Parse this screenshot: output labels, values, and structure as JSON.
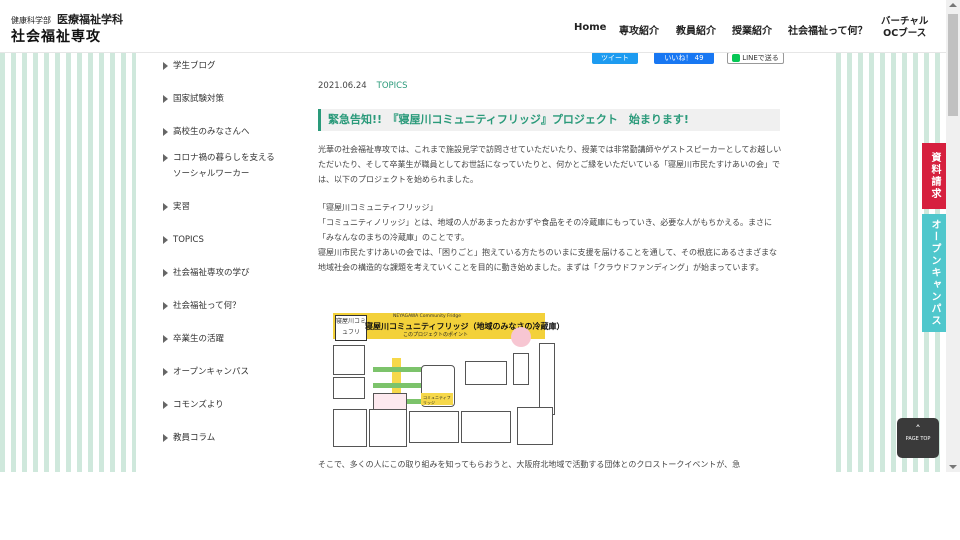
{
  "header": {
    "faculty": "健康科学部",
    "department": "医療福祉学科",
    "major": "社会福祉専攻"
  },
  "nav": {
    "items": [
      "Home",
      "専攻紹介",
      "教員紹介",
      "授業紹介",
      "社会福祉って何？"
    ],
    "virtual_oc_line1": "バーチャル",
    "virtual_oc_line2": "OCブース"
  },
  "share": {
    "tweet": "ツイート",
    "like": "いいね！ 49",
    "line": "LINEで送る"
  },
  "sidebar": {
    "items": [
      "学生ブログ",
      "国家試験対策",
      "高校生のみなさんへ",
      "コロナ禍の暮らしを支える",
      "ソーシャルワーカー",
      "実習",
      "TOPICS",
      "社会福祉専攻の学び",
      "社会福祉って何？",
      "卒業生の活躍",
      "オープンキャンパス",
      "コモンズより",
      "教員コラム"
    ]
  },
  "post": {
    "date": "2021.06.24",
    "category": "TOPICS",
    "title": "緊急告知!!　『寝屋川コミュニティフリッジ』プロジェクト　始まります!",
    "para1": "光華の社会福祉専攻では、これまで施設見学で訪問させていただいたり、授業では非常勤講師やゲストスピーカーとしてお越しいただいたり、そして卒業生が職員としてお世話になっていたりと、何かとご縁をいただいている「寝屋川市民たすけあいの会」では、以下のプロジェクトを始められました。",
    "para2": "「寝屋川コミュニティフリッジ」\n「コミュニティノリッジ」とは、地域の人があまったおかずや食品をその冷蔵庫にもっていき、必要な人がもちかえる。まさに「みなんなのまちの冷蔵庫」のことです。\n寝屋川市民たすけあいの会では、「困りごと」抱えている方たちのいまに支援を届けることを通して、その根底にあるさまざまな地域社会の構造的な課題を考えていくことを目的に動き始めました。まずは「クラウドファンディング」が始まっています。",
    "para3": "そこで、多くの人にこの取り組みを知ってもらおうと、大阪府北地域で活動する団体とのクロストークイベントが、急"
  },
  "figure": {
    "logo_text": "寝屋川コミュフリ",
    "english": "NEYAGAWA Community Fridge",
    "title": "寝屋川コミュニティフリッジ（地域のみなさの冷蔵庫）",
    "subtitle": "このプロジェクトのポイント",
    "fridge_label": "コミュニティフリッジ"
  },
  "right_tabs": {
    "request": "資料請求",
    "open_campus": "オープンキャンパス"
  },
  "page_top": "PAGE TOP",
  "colors": {
    "accent_green": "#2a9a7a",
    "stripe_green": "#cfe8dc",
    "red_tab": "#d6203e",
    "cyan_tab": "#4fc7cc"
  }
}
